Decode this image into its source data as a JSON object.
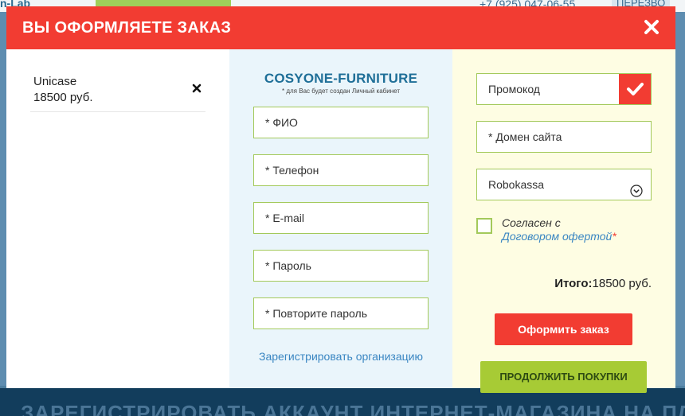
{
  "background": {
    "logo_text": "n-Lab",
    "phone": "+7 (925) 047-06-55",
    "callback_label": "ПЕРЕЗВО",
    "banner_text": "ЗАРЕГИСТРИРОВАТЬ АККАУНТ ИНТЕРНЕТ-МАГАЗИНА НА ПЛАТФОРМЕ INSALES"
  },
  "modal": {
    "title": "ВЫ ОФОРМЛЯЕТЕ ЗАКАЗ",
    "close_icon": "close-icon"
  },
  "cart": {
    "items": [
      {
        "name": "Unicase",
        "price": "18500 руб."
      }
    ]
  },
  "register": {
    "shop_name": "COSYONE-FURNITURE",
    "note": "* для Вас будет создан Личный кабинет",
    "fields": {
      "name": "* ФИО",
      "phone": "* Телефон",
      "email": "* E-mail",
      "password": "* Пароль",
      "password_repeat": "* Повторите пароль"
    },
    "org_link": "Зарегистрировать организацию"
  },
  "order": {
    "promo_placeholder": "Промокод",
    "domain_placeholder": "* Домен сайта",
    "payment_selected": "Robokassa",
    "agree_text": "Согласен с",
    "agree_link": "Договором офертой",
    "agree_required": "*",
    "total_label": "Итого:",
    "total_value": "18500 руб.",
    "submit_label": "Оформить заказ",
    "continue_label": "ПРОДОЛЖИТЬ ПОКУПКИ"
  },
  "colors": {
    "accent_red": "#f23c32",
    "accent_green": "#a7cb35",
    "field_border": "#a3c95a",
    "link_blue": "#3a86c2"
  }
}
